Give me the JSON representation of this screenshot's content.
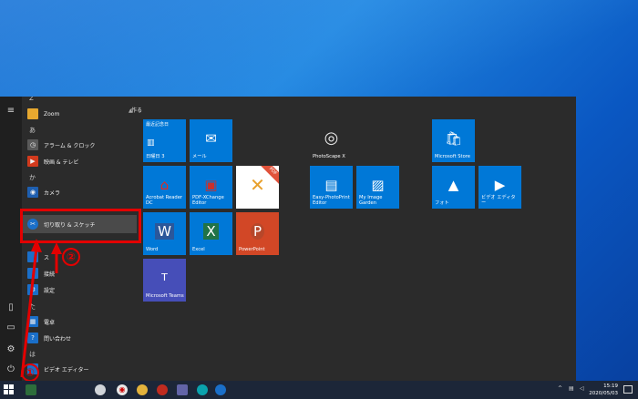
{
  "start_menu": {
    "letters": {
      "z": "Z",
      "a": "あ",
      "ka": "か",
      "ta": "た",
      "ha": "は"
    },
    "apps": {
      "zoom": "Zoom",
      "alarm": "アラーム & クロック",
      "movies": "映画 & テレビ",
      "camera": "カメラ",
      "snip": "切り取り & スケッチ",
      "settings": "設定",
      "calc": "電卓",
      "inquiry": "問い合わせ",
      "video_editor": "ビデオ エディター",
      "cut_a": "ス",
      "cut_b": "接続"
    },
    "group_label": "作る",
    "tiles": {
      "calendar": {
        "top": "最近記念日",
        "sub": "日曜日 3",
        "label": ""
      },
      "mail": "メール",
      "acrobat": "Acrobat Reader DC",
      "pdfx": "PDF-XChange Editor",
      "word": "Word",
      "excel": "Excel",
      "powerpoint": "PowerPoint",
      "teams": "Microsoft Teams",
      "photoscape": "PhotoScape X",
      "easyphoto": "Easy-PhotoPrint Editor",
      "myimage": "My Image Garden",
      "store": "Microsoft Store",
      "photos": "フォト",
      "video_editor": "ビデオ エディター"
    }
  },
  "annotation": {
    "step1": "①",
    "step2": "②"
  },
  "taskbar": {
    "time": "15:19",
    "date": "2020/05/03"
  },
  "colors": {
    "accent": "#0078d7",
    "annotation": "#e30000"
  }
}
